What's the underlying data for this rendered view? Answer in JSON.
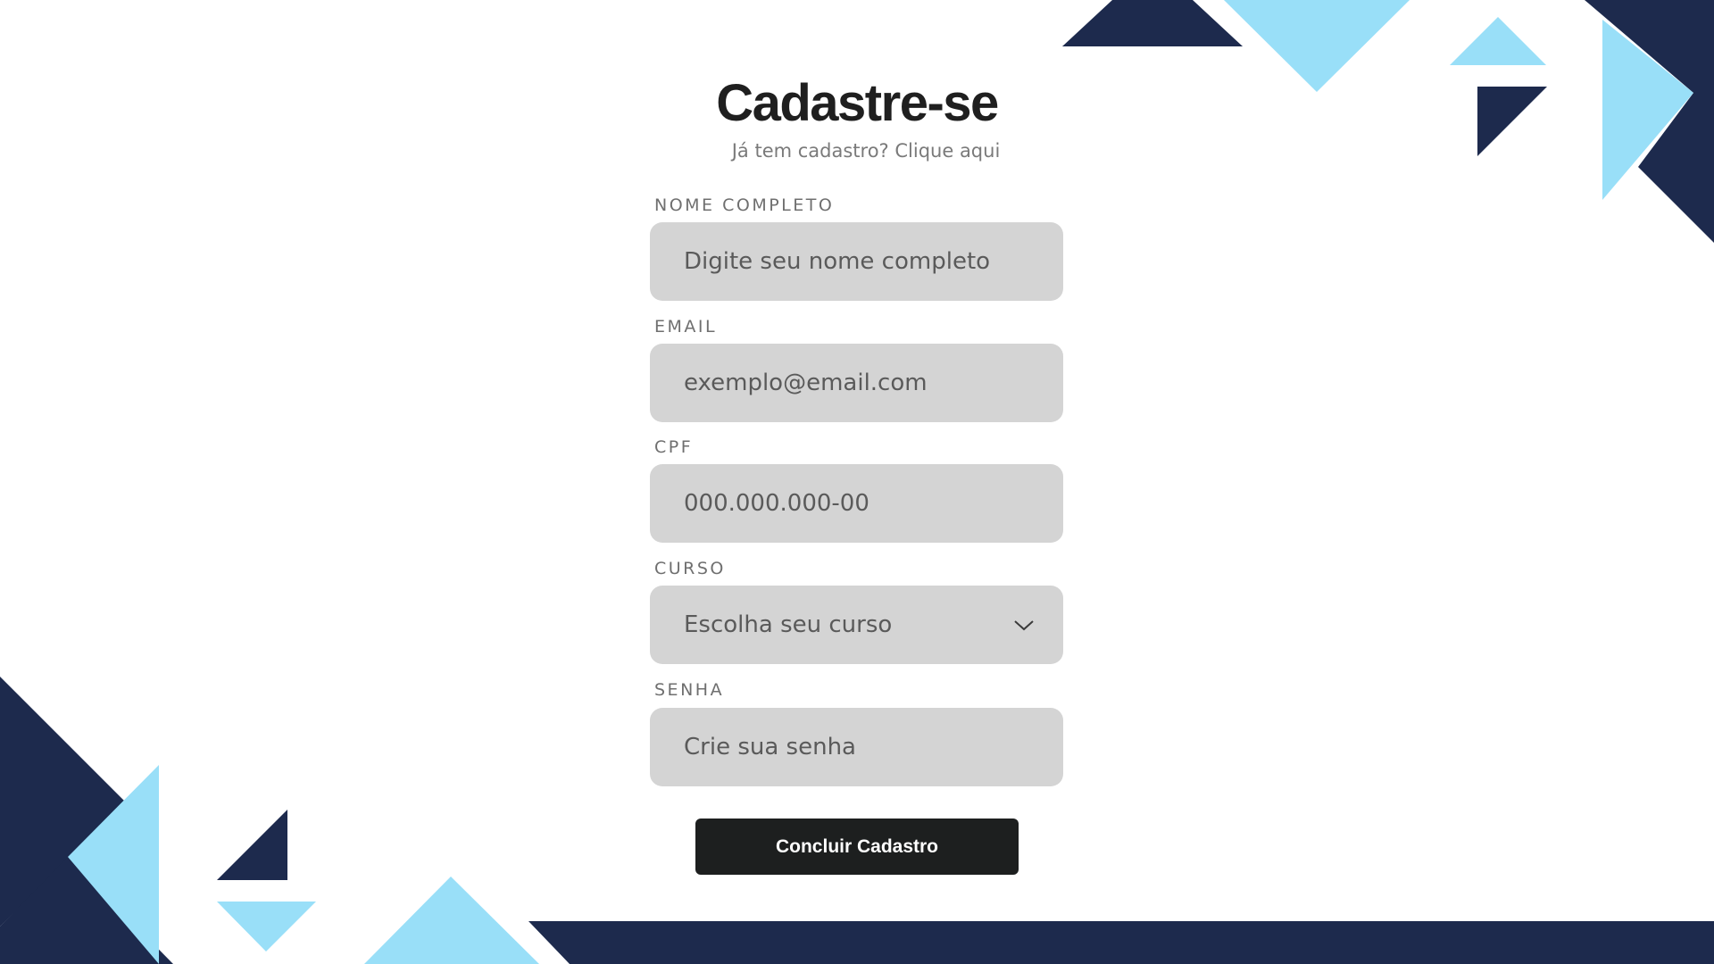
{
  "page": {
    "title": "Cadastre-se",
    "subtitle": "Já tem cadastro? Clique aqui"
  },
  "form": {
    "name": {
      "label": "NOME COMPLETO",
      "placeholder": "Digite seu nome completo"
    },
    "email": {
      "label": "EMAIL",
      "placeholder": "exemplo@email.com"
    },
    "cpf": {
      "label": "CPF",
      "placeholder": "000.000.000-00"
    },
    "course": {
      "label": "CURSO",
      "selected": "Escolha seu curso",
      "icon": "chevron-down-icon"
    },
    "password": {
      "label": "SENHA",
      "placeholder": "Crie sua senha"
    },
    "submit_label": "Concluir Cadastro"
  },
  "colors": {
    "navy": "#1d2a4d",
    "light_blue": "#99dff8",
    "input_bg": "#d4d4d4",
    "button_bg": "#1d1f1f"
  }
}
